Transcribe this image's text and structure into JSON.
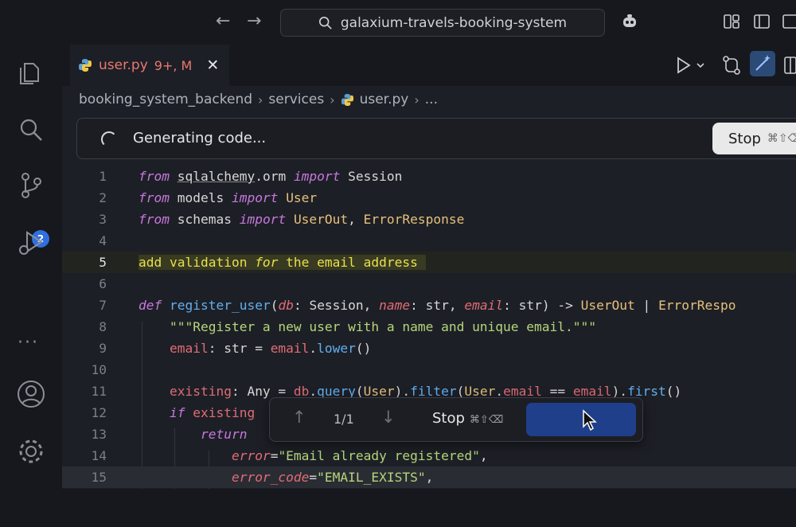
{
  "titlebar": {
    "search_text": "galaxium-travels-booking-system"
  },
  "activity": {
    "scm_badge": "2",
    "more": "···"
  },
  "tab": {
    "filename": "user.py",
    "status": "9+, M",
    "close": "✕"
  },
  "breadcrumb": [
    "booking_system_backend",
    "services",
    "user.py",
    "..."
  ],
  "generation": {
    "status_text": "Generating code...",
    "stop_label": "Stop",
    "stop_shortcut": "⌘⇧⌫"
  },
  "code": {
    "line_numbers": [
      "1",
      "2",
      "3",
      "4",
      "5",
      "6",
      "7",
      "8",
      "9",
      "10",
      "11",
      "12",
      "13",
      "14",
      "15"
    ],
    "active_line": "5"
  },
  "find_widget": {
    "count": "1/1",
    "stop_label": "Stop",
    "stop_shortcut": "⌘⇧⌫"
  },
  "colors": {
    "accent": "#2f6fe0",
    "tab_modified": "#e8786f",
    "highlight_text": "#e8e04a"
  }
}
